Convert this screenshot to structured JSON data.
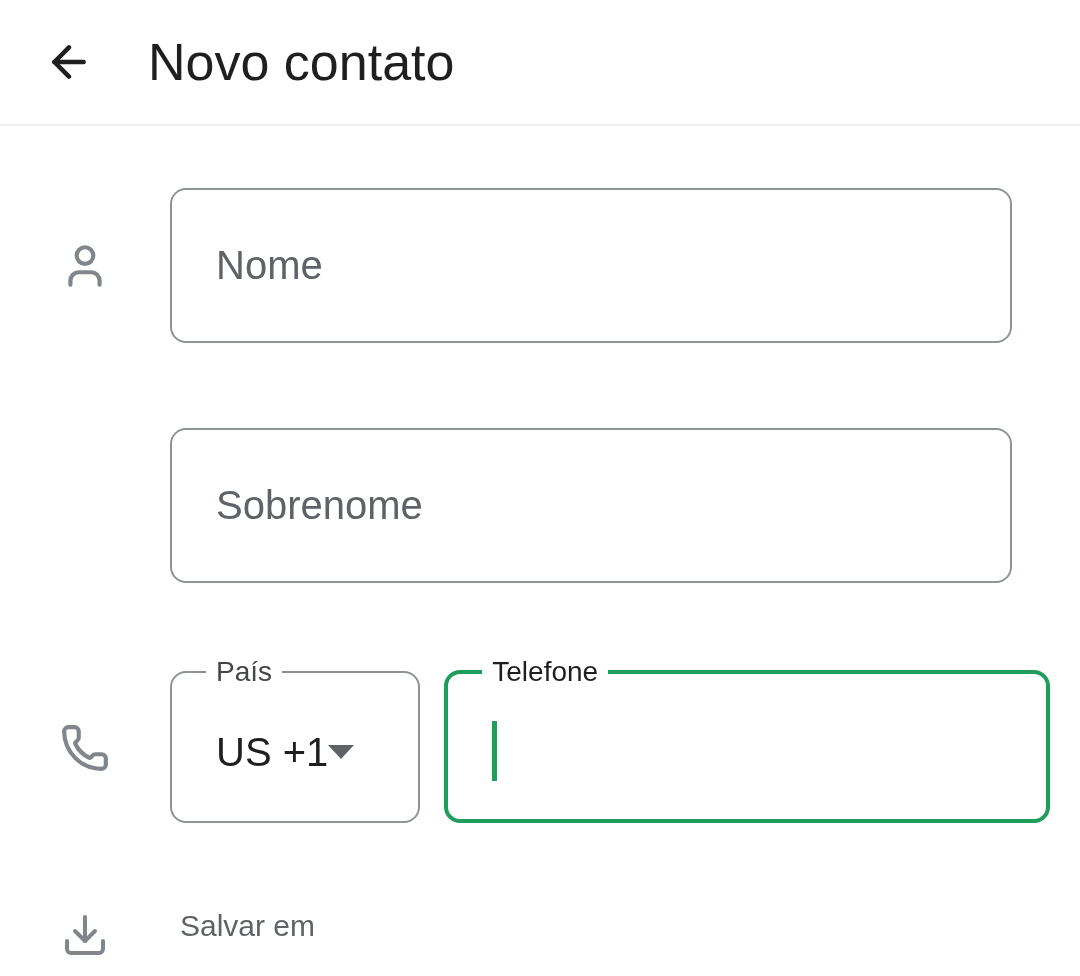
{
  "header": {
    "title": "Novo contato"
  },
  "name_fields": [
    {
      "placeholder": "Nome"
    },
    {
      "placeholder": "Sobrenome"
    }
  ],
  "country": {
    "label": "País",
    "value": "US +1"
  },
  "phone": {
    "label": "Telefone",
    "focused": true
  },
  "save_location": {
    "label": "Salvar em"
  }
}
